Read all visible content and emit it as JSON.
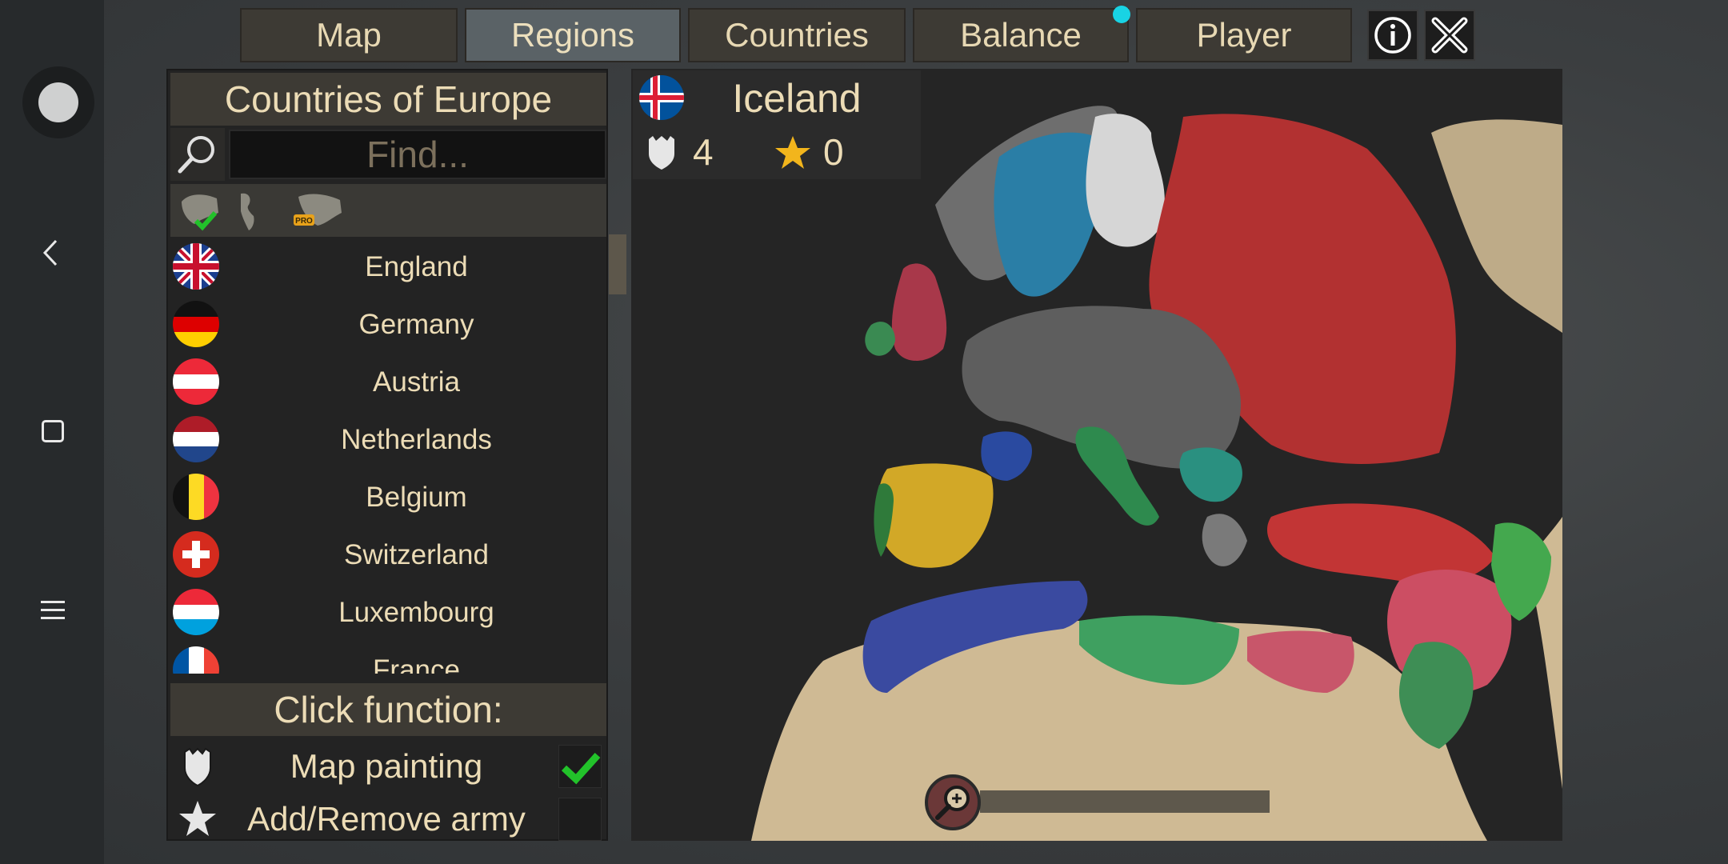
{
  "tabs": [
    {
      "label": "Map"
    },
    {
      "label": "Regions",
      "active": true
    },
    {
      "label": "Countries"
    },
    {
      "label": "Balance"
    },
    {
      "label": "Player"
    }
  ],
  "panel": {
    "title": "Countries of Europe",
    "search_placeholder": "Find...",
    "countries": [
      {
        "name": "England",
        "flag": "uk"
      },
      {
        "name": "Germany",
        "flag": "de"
      },
      {
        "name": "Austria",
        "flag": "at"
      },
      {
        "name": "Netherlands",
        "flag": "nl"
      },
      {
        "name": "Belgium",
        "flag": "be"
      },
      {
        "name": "Switzerland",
        "flag": "ch"
      },
      {
        "name": "Luxembourg",
        "flag": "lu"
      },
      {
        "name": "France",
        "flag": "fr"
      }
    ],
    "click_function_title": "Click function:",
    "options": [
      {
        "label": "Map painting",
        "checked": true,
        "icon": "shield-icon"
      },
      {
        "label": "Add/Remove army",
        "checked": false,
        "icon": "star-icon"
      }
    ]
  },
  "selected": {
    "name": "Iceland",
    "regions": "4",
    "armies": "0"
  },
  "colors": {
    "tab_bg": "#3d3a34",
    "tab_active": "#5a6266",
    "text": "#ecdcb6",
    "accent_dot": "#19d3e4",
    "check": "#22c22a"
  }
}
